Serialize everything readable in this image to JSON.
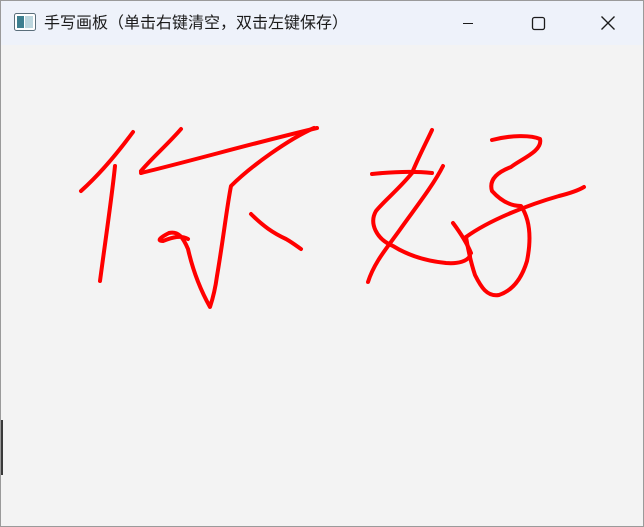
{
  "window": {
    "title": "手写画板（单击右键清空，双击左键保存）"
  },
  "titlebar_controls": {
    "minimize_icon": "minimize-icon",
    "maximize_icon": "maximize-icon",
    "close_icon": "close-icon"
  },
  "canvas": {
    "background_color": "#f3f3f3",
    "stroke_color": "#ff0000",
    "handwriting_text": "你好"
  }
}
